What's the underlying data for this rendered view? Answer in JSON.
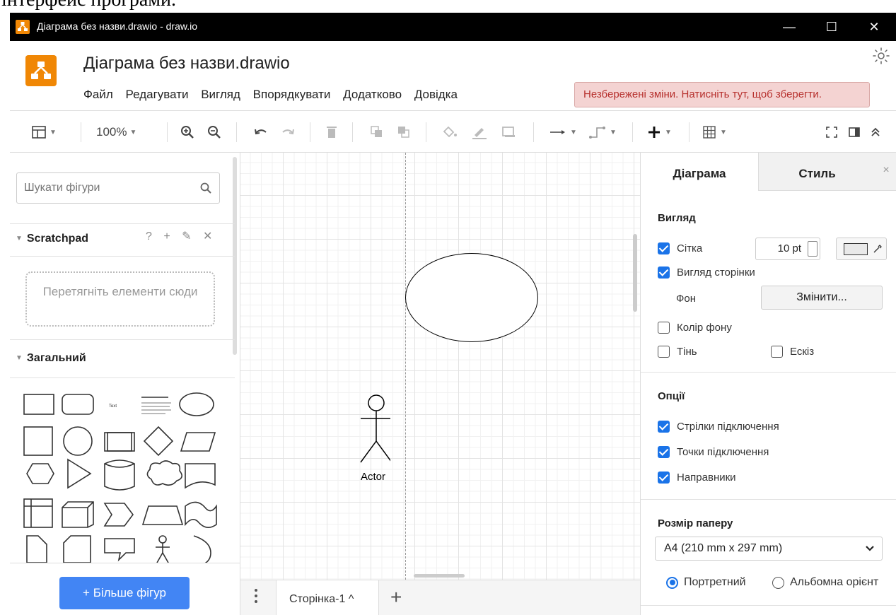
{
  "caption": "інтерфейс програми.",
  "window": {
    "title": "Діаграма без назви.drawio - draw.io",
    "minimize": "—",
    "maximize": "☐",
    "close": "✕"
  },
  "header": {
    "doc_title": "Діаграма без назви.drawio",
    "menu": [
      "Файл",
      "Редагувати",
      "Вигляд",
      "Впорядкувати",
      "Додатково",
      "Довідка"
    ],
    "unsaved_notice": "Незбережені зміни. Натисніть тут, щоб зберегти."
  },
  "toolbar": {
    "zoom": "100%"
  },
  "sidebar": {
    "search_placeholder": "Шукати фігури",
    "scratchpad_title": "Scratchpad",
    "scratchpad_tools": "? + ✎ ✕",
    "dropzone_text": "Перетягніть елементи сюди",
    "general_title": "Загальний",
    "more_shapes": "+ Більше фігур"
  },
  "canvas": {
    "actor_label": "Actor"
  },
  "pages": {
    "tab_label": "Сторінка-1 ^",
    "add": "+"
  },
  "format_panel": {
    "tab_diagram": "Діаграма",
    "tab_style": "Стиль",
    "close": "×",
    "view_section": "Вигляд",
    "grid_label": "Сітка",
    "grid_size": "10 pt",
    "page_view_label": "Вигляд сторінки",
    "background_label": "Фон",
    "change_button": "Змінити...",
    "bg_color_label": "Колір фону",
    "shadow_label": "Тінь",
    "sketch_label": "Ескіз",
    "options_section": "Опції",
    "connection_arrows": "Стрілки підключення",
    "connection_points": "Точки підключення",
    "guides": "Направники",
    "paper_section": "Розмір паперу",
    "paper_size": "A4 (210 mm x 297 mm)",
    "portrait": "Портретний",
    "landscape": "Альбомна орієнт"
  }
}
